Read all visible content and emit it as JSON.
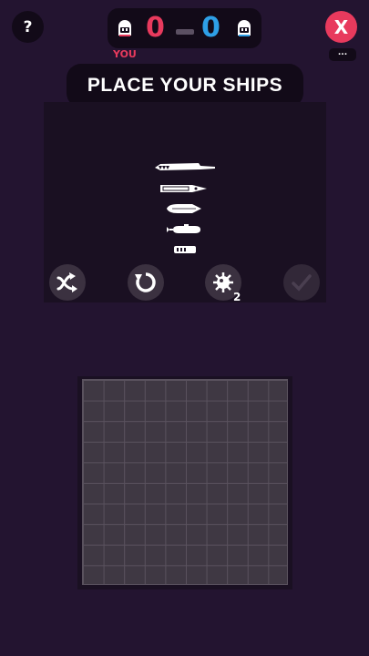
{
  "header": {
    "help_label": "?",
    "close_label": "X",
    "more_label": "...",
    "you_label": "YOU",
    "score_left": "0",
    "score_right": "0",
    "title": "PLACE YOUR SHIPS"
  },
  "players": {
    "left_avatar": "ghost-avatar",
    "right_avatar": "ghost-avatar"
  },
  "fleet": {
    "ships": [
      "carrier",
      "battleship",
      "cruiser",
      "submarine",
      "destroyer"
    ]
  },
  "tools": {
    "mine_count": "2"
  },
  "board": {
    "rows": 10,
    "cols": 10
  },
  "colors": {
    "background": "#231430",
    "panel": "#1a1022",
    "accent_red": "#e83a5d",
    "accent_blue": "#2e9fe6",
    "grid_cell": "#3f3843"
  }
}
